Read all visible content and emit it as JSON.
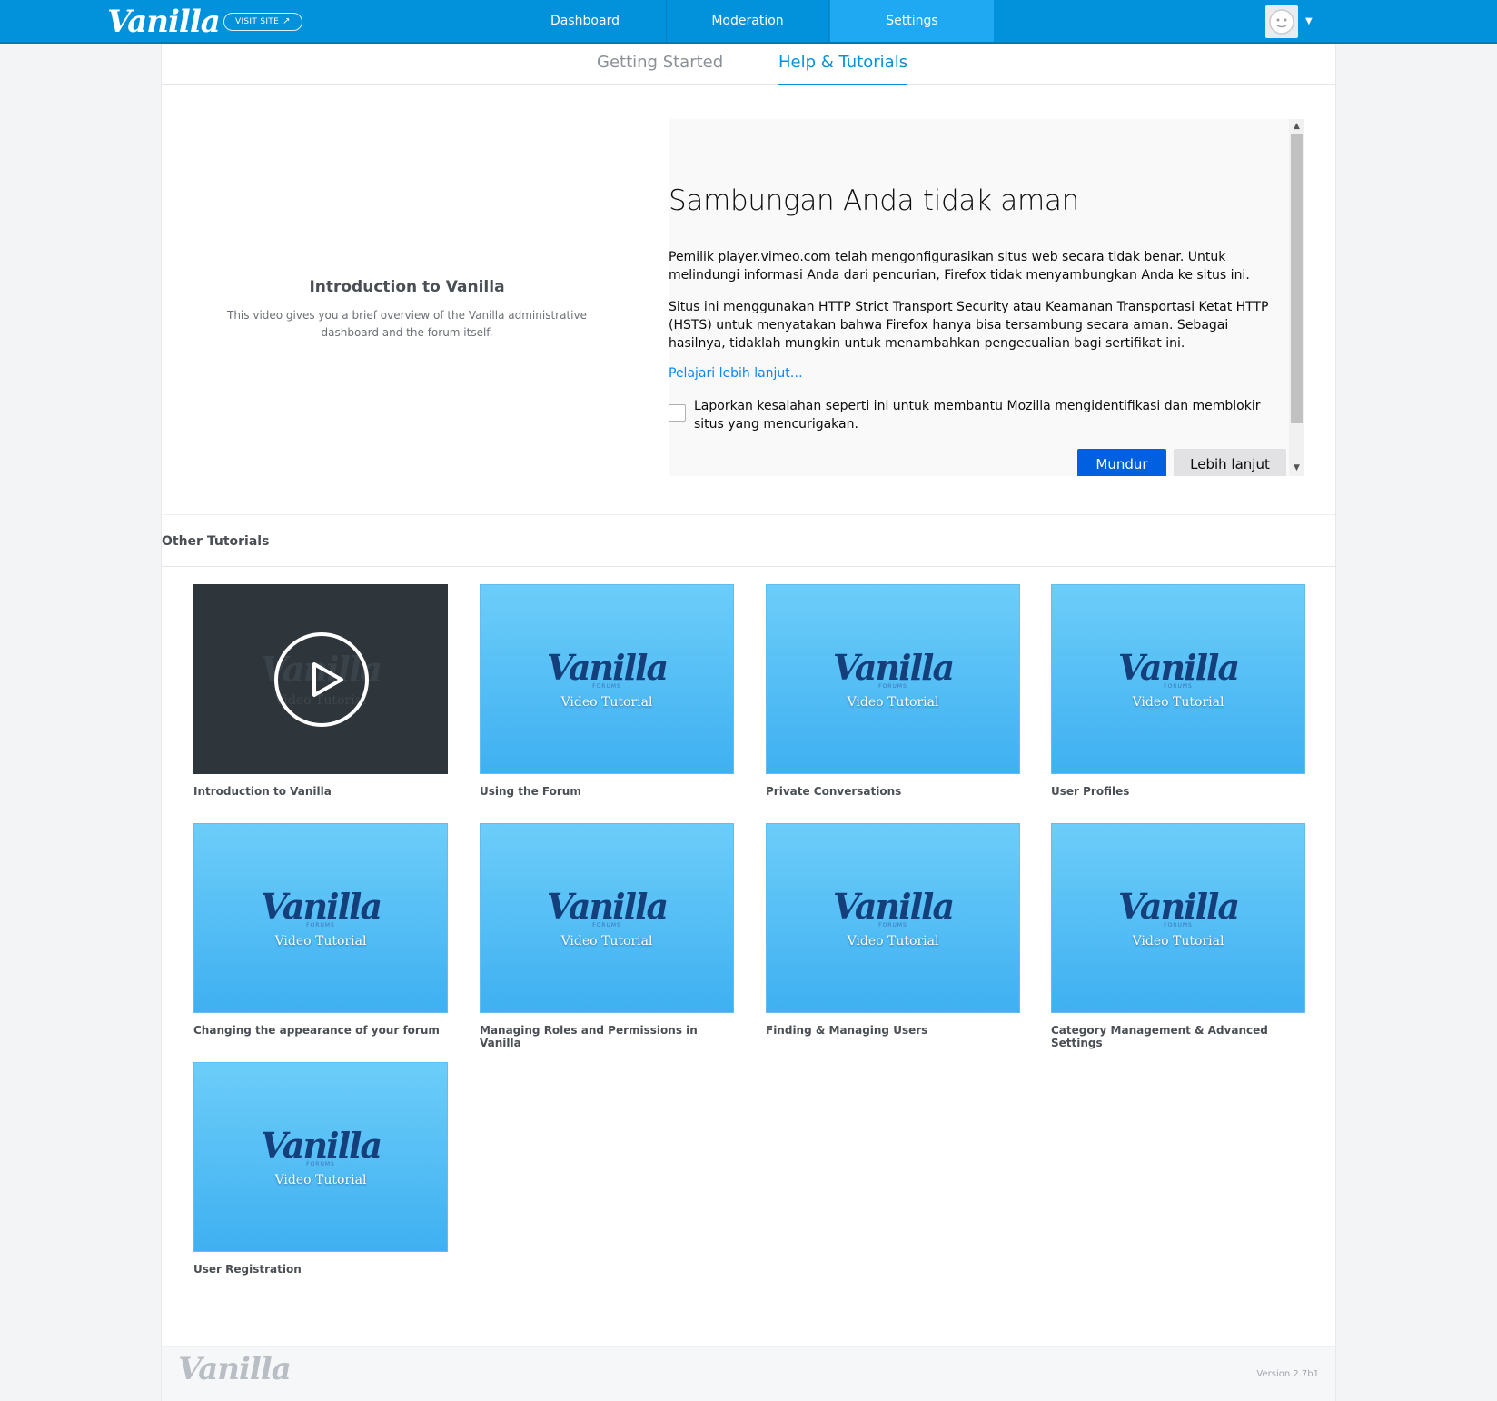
{
  "brand": {
    "logo": "Vanilla",
    "accent": "#0291db"
  },
  "topbar": {
    "visit_site": "VISIT SITE",
    "nav": [
      {
        "label": "Dashboard",
        "active": false
      },
      {
        "label": "Moderation",
        "active": false
      },
      {
        "label": "Settings",
        "active": true
      }
    ],
    "avatar_icon": "user-avatar-icon",
    "menu_icon": "caret-down-icon"
  },
  "subnav": {
    "tabs": [
      {
        "label": "Getting Started",
        "active": false
      },
      {
        "label": "Help & Tutorials",
        "active": true
      }
    ]
  },
  "featured": {
    "title": "Introduction to Vanilla",
    "description": "This video gives you a brief overview of the Vanilla administrative dashboard and the forum itself."
  },
  "embed_error": {
    "title": "Sambungan Anda tidak aman",
    "paragraph1": "Pemilik player.vimeo.com telah mengonfigurasikan situs web secara tidak benar. Untuk melindungi informasi Anda dari pencurian, Firefox tidak menyambungkan Anda ke situs ini.",
    "paragraph2": "Situs ini menggunakan HTTP Strict Transport Security atau Keamanan Transportasi Ketat HTTP (HSTS) untuk menyatakan bahwa Firefox hanya bisa tersambung secara aman. Sebagai hasilnya, tidaklah mungkin untuk menambahkan pengecualian bagi sertifikat ini.",
    "learn_more": "Pelajari lebih lanjut…",
    "report_checkbox": "Laporkan kesalahan seperti ini untuk membantu Mozilla mengidentifikasi dan memblokir situs yang mencurigakan.",
    "report_checked": false,
    "back_button": "Mundur",
    "advanced_button": "Lebih lanjut"
  },
  "other_tutorials": {
    "heading": "Other Tutorials",
    "thumb_logo": "Vanilla",
    "thumb_forums": "FORUMS",
    "thumb_subtitle": "Video Tutorial",
    "items": [
      {
        "label": "Introduction to Vanilla",
        "playing": true
      },
      {
        "label": "Using the Forum"
      },
      {
        "label": "Private Conversations"
      },
      {
        "label": "User Profiles"
      },
      {
        "label": "Changing the appearance of your forum"
      },
      {
        "label": "Managing Roles and Permissions in Vanilla"
      },
      {
        "label": "Finding & Managing Users"
      },
      {
        "label": "Category Management & Advanced Settings"
      },
      {
        "label": "User Registration"
      }
    ]
  },
  "footer": {
    "logo": "Vanilla",
    "version": "Version 2.7b1"
  }
}
